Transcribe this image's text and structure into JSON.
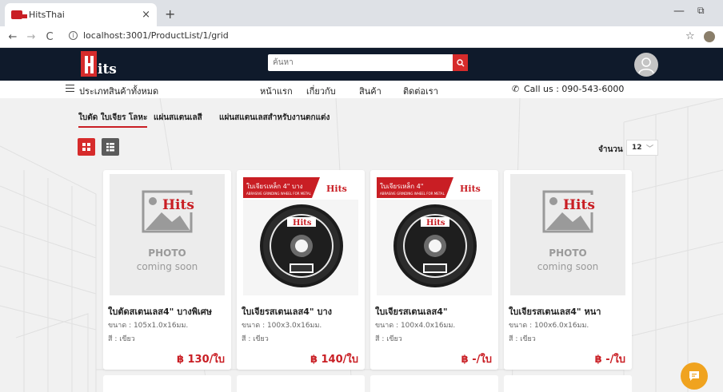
{
  "browser": {
    "tab_title": "HitsThai",
    "tab_close": "×",
    "new_tab": "+",
    "url": "localhost:3001/ProductList/1/grid",
    "back": "←",
    "forward": "→",
    "reload": "C",
    "star": "☆",
    "minimize": "—",
    "maximize": "⧉"
  },
  "header": {
    "logo_text": "Hits",
    "search_placeholder": "ค้นหา",
    "brand_color": "#c91e24",
    "header_bg": "#0f1a2b"
  },
  "nav": {
    "categories_label": "ประเภทสินค้าทั้งหมด",
    "links": [
      "หน้าแรก",
      "เกี่ยวกับ",
      "สินค้า",
      "ติดต่อเรา"
    ],
    "call_label": "Call us : 090-543-6000"
  },
  "category_tabs": [
    "ใบตัด ใบเจียร โลหะ",
    "แผ่นสแตนเลสี",
    "แผ่นสแตนเลสสำหรับงานตกแต่ง"
  ],
  "toolbar": {
    "qty_label": "จำนวน",
    "qty_value": "12",
    "qty_caret": "﹀"
  },
  "products": [
    {
      "name": "ใบตัดสเตนเลส4\" บางพิเศษ",
      "size": "ขนาด : 105x1.0x16มม.",
      "color": "สี : เขียว",
      "price": "฿ 130/ใบ",
      "image": "photo-coming-soon"
    },
    {
      "name": "ใบเจียรสเตนเลส4\" บาง",
      "size": "ขนาด : 100x3.0x16มม.",
      "color": "สี : เขียว",
      "price": "฿ 140/ใบ",
      "image": "grinding-disc"
    },
    {
      "name": "ใบเจียรสเตนเลส4\"",
      "size": "ขนาด : 100x4.0x16มม.",
      "color": "สี : เขียว",
      "price": "฿ -/ใบ",
      "image": "grinding-disc"
    },
    {
      "name": "ใบเจียรสเตนเลส4\" หนา",
      "size": "ขนาด : 100x6.0x16มม.",
      "color": "สี : เขียว",
      "price": "฿ -/ใบ",
      "image": "photo-coming-soon"
    }
  ],
  "placeholder": {
    "photo": "PHOTO",
    "coming_soon": "coming soon",
    "brand": "Hits"
  },
  "disc_banner": {
    "title": "ใบเจียรเหล็ก 4\" บาง",
    "title_plain": "ใบเจียรเหล็ก 4\"",
    "sub": "ABRASIVE GRINDING WHEEL FOR METAL"
  }
}
